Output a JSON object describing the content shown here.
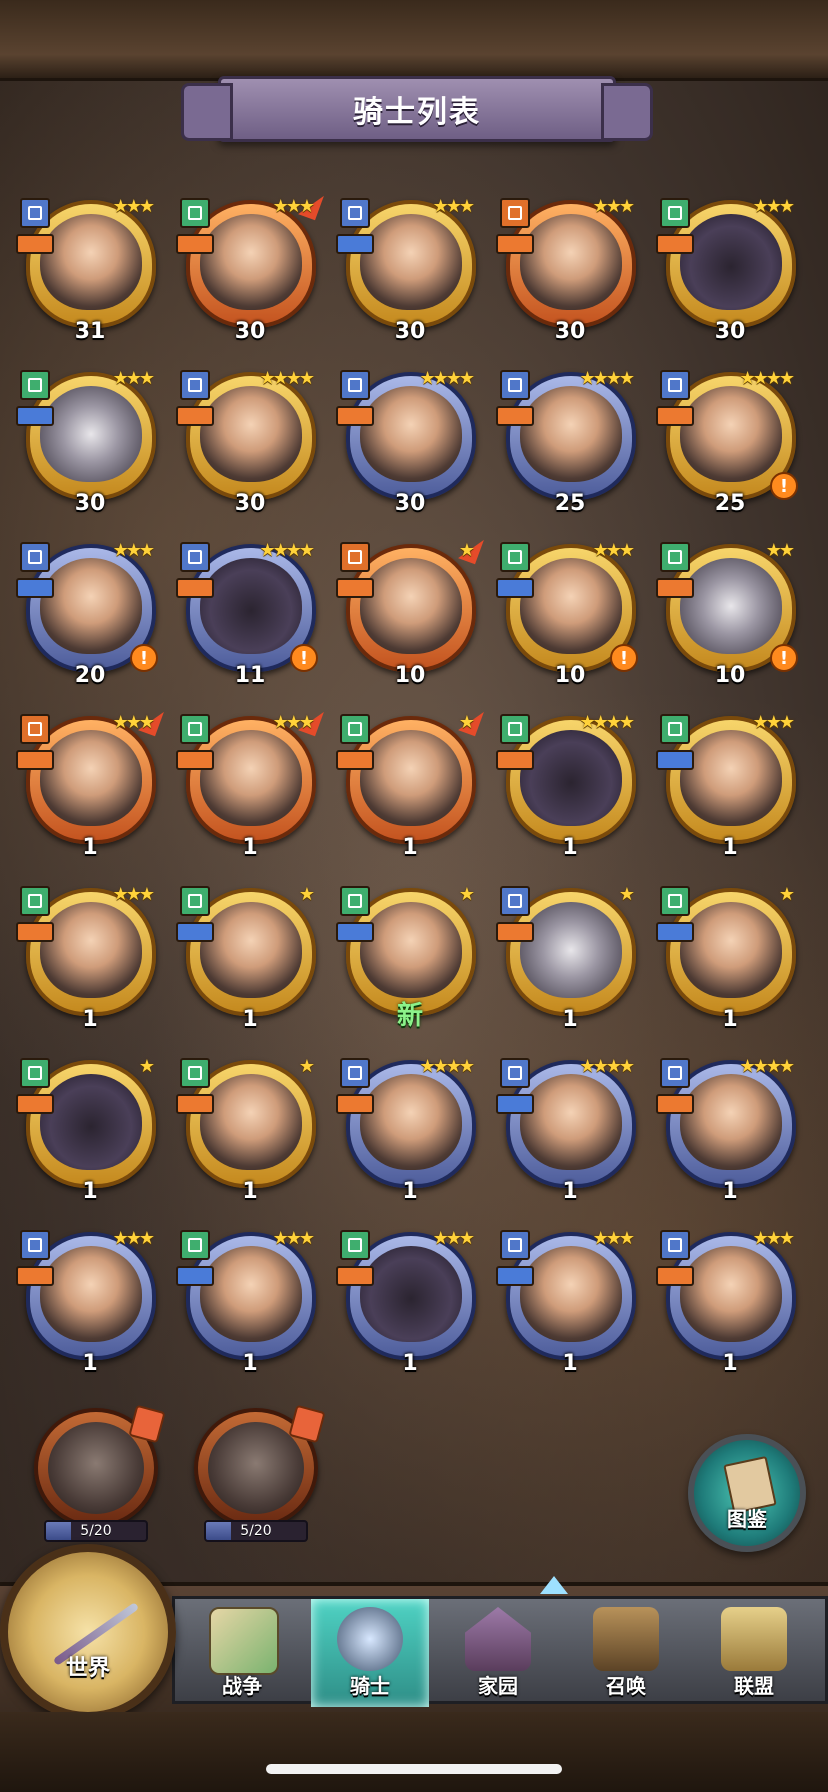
{
  "header": {
    "title": "骑士列表"
  },
  "knights": [
    {
      "level": "31",
      "stars": "★★★",
      "frame": "gold",
      "cls": "blue",
      "role": "orange"
    },
    {
      "level": "30",
      "stars": "★★★",
      "frame": "orange",
      "cls": "green",
      "role": "orange",
      "up": true
    },
    {
      "level": "30",
      "stars": "★★★",
      "frame": "gold",
      "cls": "blue",
      "role": "blue"
    },
    {
      "level": "30",
      "stars": "★★★",
      "frame": "orange",
      "cls": "orange",
      "role": "orange"
    },
    {
      "level": "30",
      "stars": "★★★",
      "frame": "gold",
      "cls": "green",
      "role": "orange"
    },
    {
      "level": "30",
      "stars": "★★★",
      "frame": "gold",
      "cls": "green",
      "role": "blue"
    },
    {
      "level": "30",
      "stars": "★★★★",
      "frame": "gold",
      "cls": "blue",
      "role": "orange"
    },
    {
      "level": "30",
      "stars": "★★★★",
      "frame": "blue",
      "cls": "blue",
      "role": "orange"
    },
    {
      "level": "25",
      "stars": "★★★★",
      "frame": "blue",
      "cls": "blue",
      "role": "orange"
    },
    {
      "level": "25",
      "stars": "★★★★",
      "frame": "gold",
      "cls": "blue",
      "role": "orange",
      "alert": true
    },
    {
      "level": "20",
      "stars": "★★★",
      "frame": "blue",
      "cls": "blue",
      "role": "blue",
      "alert": true
    },
    {
      "level": "11",
      "stars": "★★★★",
      "frame": "blue",
      "cls": "blue",
      "role": "orange",
      "alert": true
    },
    {
      "level": "10",
      "stars": "★",
      "frame": "orange",
      "cls": "orange",
      "role": "orange",
      "up": true
    },
    {
      "level": "10",
      "stars": "★★★",
      "frame": "gold",
      "cls": "green",
      "role": "blue",
      "alert": true
    },
    {
      "level": "10",
      "stars": "★★",
      "frame": "gold",
      "cls": "green",
      "role": "orange",
      "alert": true
    },
    {
      "level": "1",
      "stars": "★★★",
      "frame": "orange",
      "cls": "orange",
      "role": "orange",
      "up": true
    },
    {
      "level": "1",
      "stars": "★★★",
      "frame": "orange",
      "cls": "green",
      "role": "orange",
      "up": true
    },
    {
      "level": "1",
      "stars": "★",
      "frame": "orange",
      "cls": "green",
      "role": "orange",
      "up": true
    },
    {
      "level": "1",
      "stars": "★★★★",
      "frame": "gold",
      "cls": "green",
      "role": "orange"
    },
    {
      "level": "1",
      "stars": "★★★",
      "frame": "gold",
      "cls": "green",
      "role": "blue"
    },
    {
      "level": "1",
      "stars": "★★★",
      "frame": "gold",
      "cls": "green",
      "role": "orange"
    },
    {
      "level": "1",
      "stars": "★",
      "frame": "gold",
      "cls": "green",
      "role": "blue"
    },
    {
      "level": "新",
      "stars": "★",
      "frame": "gold",
      "cls": "green",
      "role": "blue",
      "isNew": true
    },
    {
      "level": "1",
      "stars": "★",
      "frame": "gold",
      "cls": "blue",
      "role": "orange"
    },
    {
      "level": "1",
      "stars": "★",
      "frame": "gold",
      "cls": "green",
      "role": "blue"
    },
    {
      "level": "1",
      "stars": "★",
      "frame": "gold",
      "cls": "green",
      "role": "orange"
    },
    {
      "level": "1",
      "stars": "★",
      "frame": "gold",
      "cls": "green",
      "role": "orange"
    },
    {
      "level": "1",
      "stars": "★★★★",
      "frame": "blue",
      "cls": "blue",
      "role": "orange"
    },
    {
      "level": "1",
      "stars": "★★★★",
      "frame": "blue",
      "cls": "blue",
      "role": "blue"
    },
    {
      "level": "1",
      "stars": "★★★★",
      "frame": "blue",
      "cls": "blue",
      "role": "orange"
    },
    {
      "level": "1",
      "stars": "★★★",
      "frame": "blue",
      "cls": "blue",
      "role": "orange"
    },
    {
      "level": "1",
      "stars": "★★★",
      "frame": "blue",
      "cls": "green",
      "role": "blue"
    },
    {
      "level": "1",
      "stars": "★★★",
      "frame": "blue",
      "cls": "green",
      "role": "orange"
    },
    {
      "level": "1",
      "stars": "★★★",
      "frame": "blue",
      "cls": "blue",
      "role": "blue"
    },
    {
      "level": "1",
      "stars": "★★★",
      "frame": "blue",
      "cls": "blue",
      "role": "orange"
    }
  ],
  "locked_knights": [
    {
      "progress": "5/20",
      "fraction": 0.25
    },
    {
      "progress": "5/20",
      "fraction": 0.25
    }
  ],
  "codex": {
    "label": "图鉴"
  },
  "nav": {
    "world": "世界",
    "tabs": [
      {
        "label": "战争",
        "art": "map"
      },
      {
        "label": "骑士",
        "art": "knight",
        "active": true
      },
      {
        "label": "家园",
        "art": "home"
      },
      {
        "label": "召唤",
        "art": "train"
      },
      {
        "label": "联盟",
        "art": "alliance"
      }
    ]
  }
}
